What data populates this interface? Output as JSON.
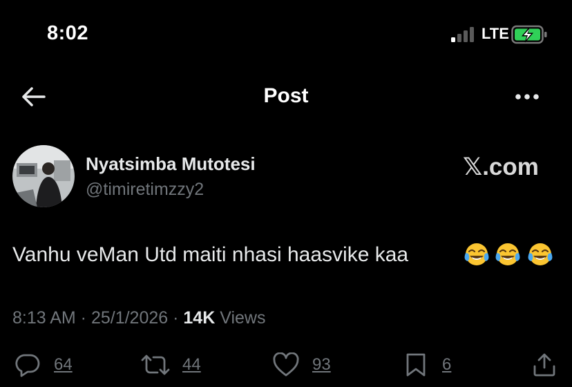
{
  "status_bar": {
    "time": "8:02",
    "network": "LTE",
    "battery_state": "charging",
    "battery_color": "#30d158"
  },
  "nav": {
    "title": "Post",
    "back_icon": "arrow-left-icon",
    "more_icon": "more-horizontal-icon"
  },
  "post": {
    "author": {
      "name": "Nyatsimba Mutotesi",
      "handle": "@timiretimzzy2"
    },
    "watermark": "𝕏.com",
    "text": "Vanhu veMan Utd maiti nhasi haasvike kaa",
    "emojis": [
      "tears-of-joy-emoji",
      "tears-of-joy-emoji",
      "tears-of-joy-emoji"
    ],
    "meta": {
      "time": "8:13 AM",
      "separator": " · ",
      "date": "25/1/2026",
      "views_count": "14K",
      "views_label": "Views"
    },
    "actions": {
      "replies": "64",
      "reposts": "44",
      "likes": "93",
      "bookmarks": "6"
    }
  },
  "colors": {
    "background": "#000000",
    "text_primary": "#e7e9ea",
    "text_secondary": "#71767b"
  }
}
